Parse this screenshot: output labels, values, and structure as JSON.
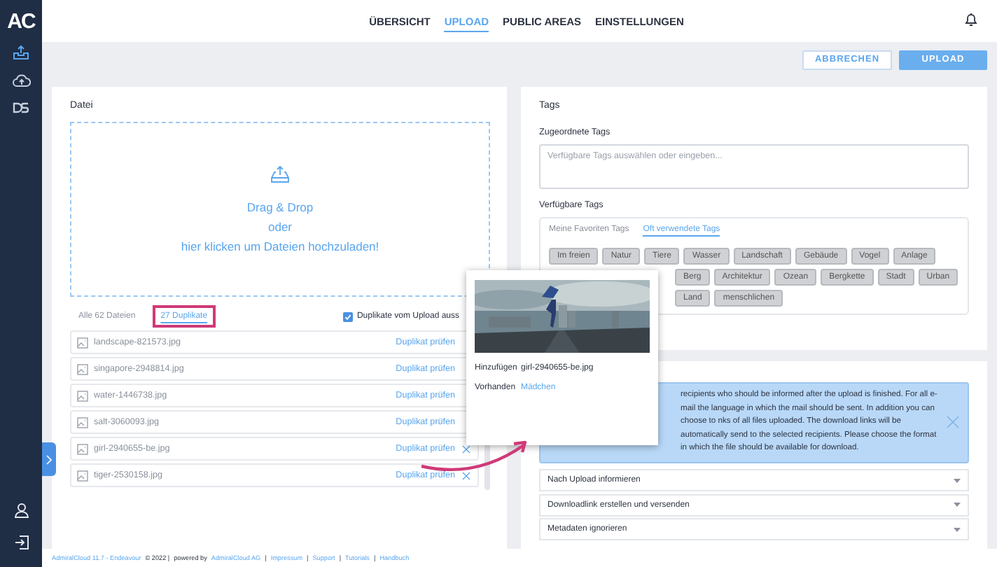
{
  "sidebar": {
    "logo": "AC",
    "items": [
      {
        "selected": true
      },
      {
        "selected": false
      },
      {
        "selected": false
      }
    ]
  },
  "nav": {
    "tabs": [
      {
        "label": "ÜBERSICHT",
        "selected": false
      },
      {
        "label": "UPLOAD",
        "selected": true
      },
      {
        "label": "PUBLIC AREAS",
        "selected": false
      },
      {
        "label": "EINSTELLUNGEN",
        "selected": false
      }
    ]
  },
  "toolbar": {
    "buttons": [
      {
        "label": "ABBRECHEN",
        "kind": "outline"
      },
      {
        "label": "UPLOAD",
        "kind": "primary"
      }
    ]
  },
  "file_panel": {
    "title": "Datei",
    "dropzone": {
      "lines": [
        "Drag & Drop",
        "oder",
        "hier klicken um Dateien hochzuladen!"
      ]
    },
    "tabs": [
      {
        "label": "Alle 62 Dateien",
        "selected": false,
        "highlighted": false
      },
      {
        "label": "27 Duplikate",
        "selected": true,
        "highlighted": true
      }
    ],
    "exclude_duplicates": {
      "label": "Duplikate vom Upload auss",
      "checked": true
    },
    "files": [
      {
        "name": "landscape-821573.jpg",
        "action": "Duplikat prüfen",
        "remove_icon": false
      },
      {
        "name": "singapore-2948814.jpg",
        "action": "Duplikat prüfen",
        "remove_icon": false
      },
      {
        "name": "water-1446738.jpg",
        "action": "Duplikat prüfen",
        "remove_icon": false
      },
      {
        "name": "salt-3060093.jpg",
        "action": "Duplikat prüfen",
        "remove_icon": false
      },
      {
        "name": "girl-2940655-be.jpg",
        "action": "Duplikat prüfen",
        "remove_icon": true
      },
      {
        "name": "tiger-2530158.jpg",
        "action": "Duplikat prüfen",
        "remove_icon": true
      }
    ]
  },
  "tags_panel": {
    "title": "Tags",
    "assigned_label": "Zugeordnete Tags",
    "assigned_field": {
      "placeholder": "Verfügbare Tags auswählen oder eingeben..."
    },
    "available_label": "Verfügbare Tags",
    "tabs": [
      {
        "label": "Meine Favoriten Tags",
        "selected": false
      },
      {
        "label": "Oft verwendete Tags",
        "selected": true
      }
    ],
    "tag_rows": [
      [
        "Im freien",
        "Natur",
        "Tiere",
        "Wasser",
        "Landschaft",
        "Gebäude",
        "Vogel",
        "Anlage"
      ],
      [
        "Berg",
        "Architektur",
        "Ozean",
        "Bergkette",
        "Stadt",
        "Urban"
      ],
      [
        "Land",
        "menschlichen"
      ]
    ]
  },
  "options_panel": {
    "info": "recipients who should be informed after the upload is finished. For all e-mail the language in which the mail should be sent. In addition you can choose to nks of all files uploaded. The download links will be automatically send to the selected recipients. Please choose the format in which the file should be available for download.",
    "sections": [
      {
        "label": "Nach Upload informieren",
        "expanded": false
      },
      {
        "label": "Downloadlink erstellen und versenden",
        "expanded": false
      },
      {
        "label": "Metadaten ignorieren",
        "expanded": false
      }
    ]
  },
  "duplicate_popup": {
    "rows": [
      {
        "label": "Hinzufügen",
        "value": "girl-2940655-be.jpg",
        "kind": "text"
      },
      {
        "label": "Vorhanden",
        "value": "Mädchen",
        "kind": "link"
      }
    ]
  },
  "footer": [
    {
      "text": "AdmiralCloud 11.7 - Endeavour",
      "kind": "link"
    },
    {
      "text": "© 2022 |",
      "kind": "text"
    },
    {
      "text": "powered by",
      "kind": "text"
    },
    {
      "text": "AdmiralCloud AG",
      "kind": "link"
    },
    {
      "text": "|",
      "kind": "text"
    },
    {
      "text": "Impressum",
      "kind": "link"
    },
    {
      "text": "|",
      "kind": "text"
    },
    {
      "text": "Support",
      "kind": "link"
    },
    {
      "text": "|",
      "kind": "text"
    },
    {
      "text": "Tutorials",
      "kind": "link"
    },
    {
      "text": "|",
      "kind": "text"
    },
    {
      "text": "Handbuch",
      "kind": "link"
    }
  ]
}
